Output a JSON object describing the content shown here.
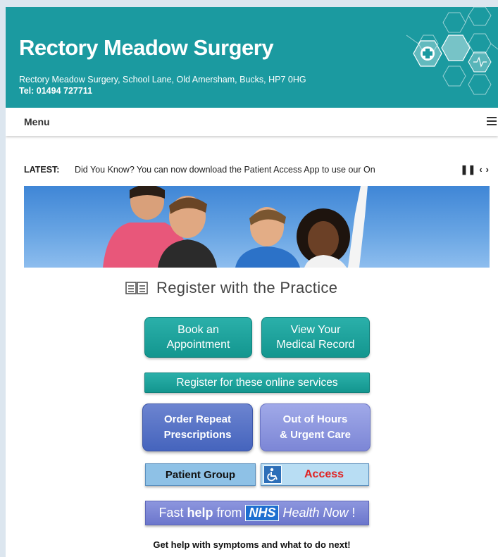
{
  "header": {
    "title": "Rectory Meadow Surgery",
    "address": "Rectory Meadow Surgery, School Lane, Old Amersham, Bucks, HP7 0HG",
    "tel": "Tel: 01494 727711",
    "background_color": "#1b9aa0"
  },
  "menu": {
    "label": "Menu",
    "icon": "hamburger-icon"
  },
  "ticker": {
    "label": "LATEST:",
    "text": "Did You Know? You can now download the Patient Access App to use our On",
    "controls": [
      "pause-icon",
      "chevron-left-icon",
      "chevron-right-icon"
    ]
  },
  "register": {
    "label": "Register with the Practice",
    "icon": "open-book-icon"
  },
  "buttons": {
    "book_line1": "Book an",
    "book_line2": "Appointment",
    "record_line1": "View Your",
    "record_line2": "Medical Record",
    "online": "Register for these online services",
    "repeat_line1": "Order Repeat",
    "repeat_line2": "Prescriptions",
    "ooh_line1": "Out of Hours",
    "ooh_line2": "& Urgent Care",
    "group": "Patient Group",
    "access": "Access",
    "access_icon": "wheelchair-icon"
  },
  "nhs": {
    "fast": "Fast",
    "help": "help",
    "from": "from",
    "logo": "NHS",
    "health_now": "Health Now",
    "bang": "!"
  },
  "footer_text": "Get help with symptoms and what to do next!",
  "colors": {
    "teal": "#1b9aa0",
    "blue_button": "#4564bd",
    "lavender_button": "#7c86d6",
    "access_red": "#e02222"
  }
}
